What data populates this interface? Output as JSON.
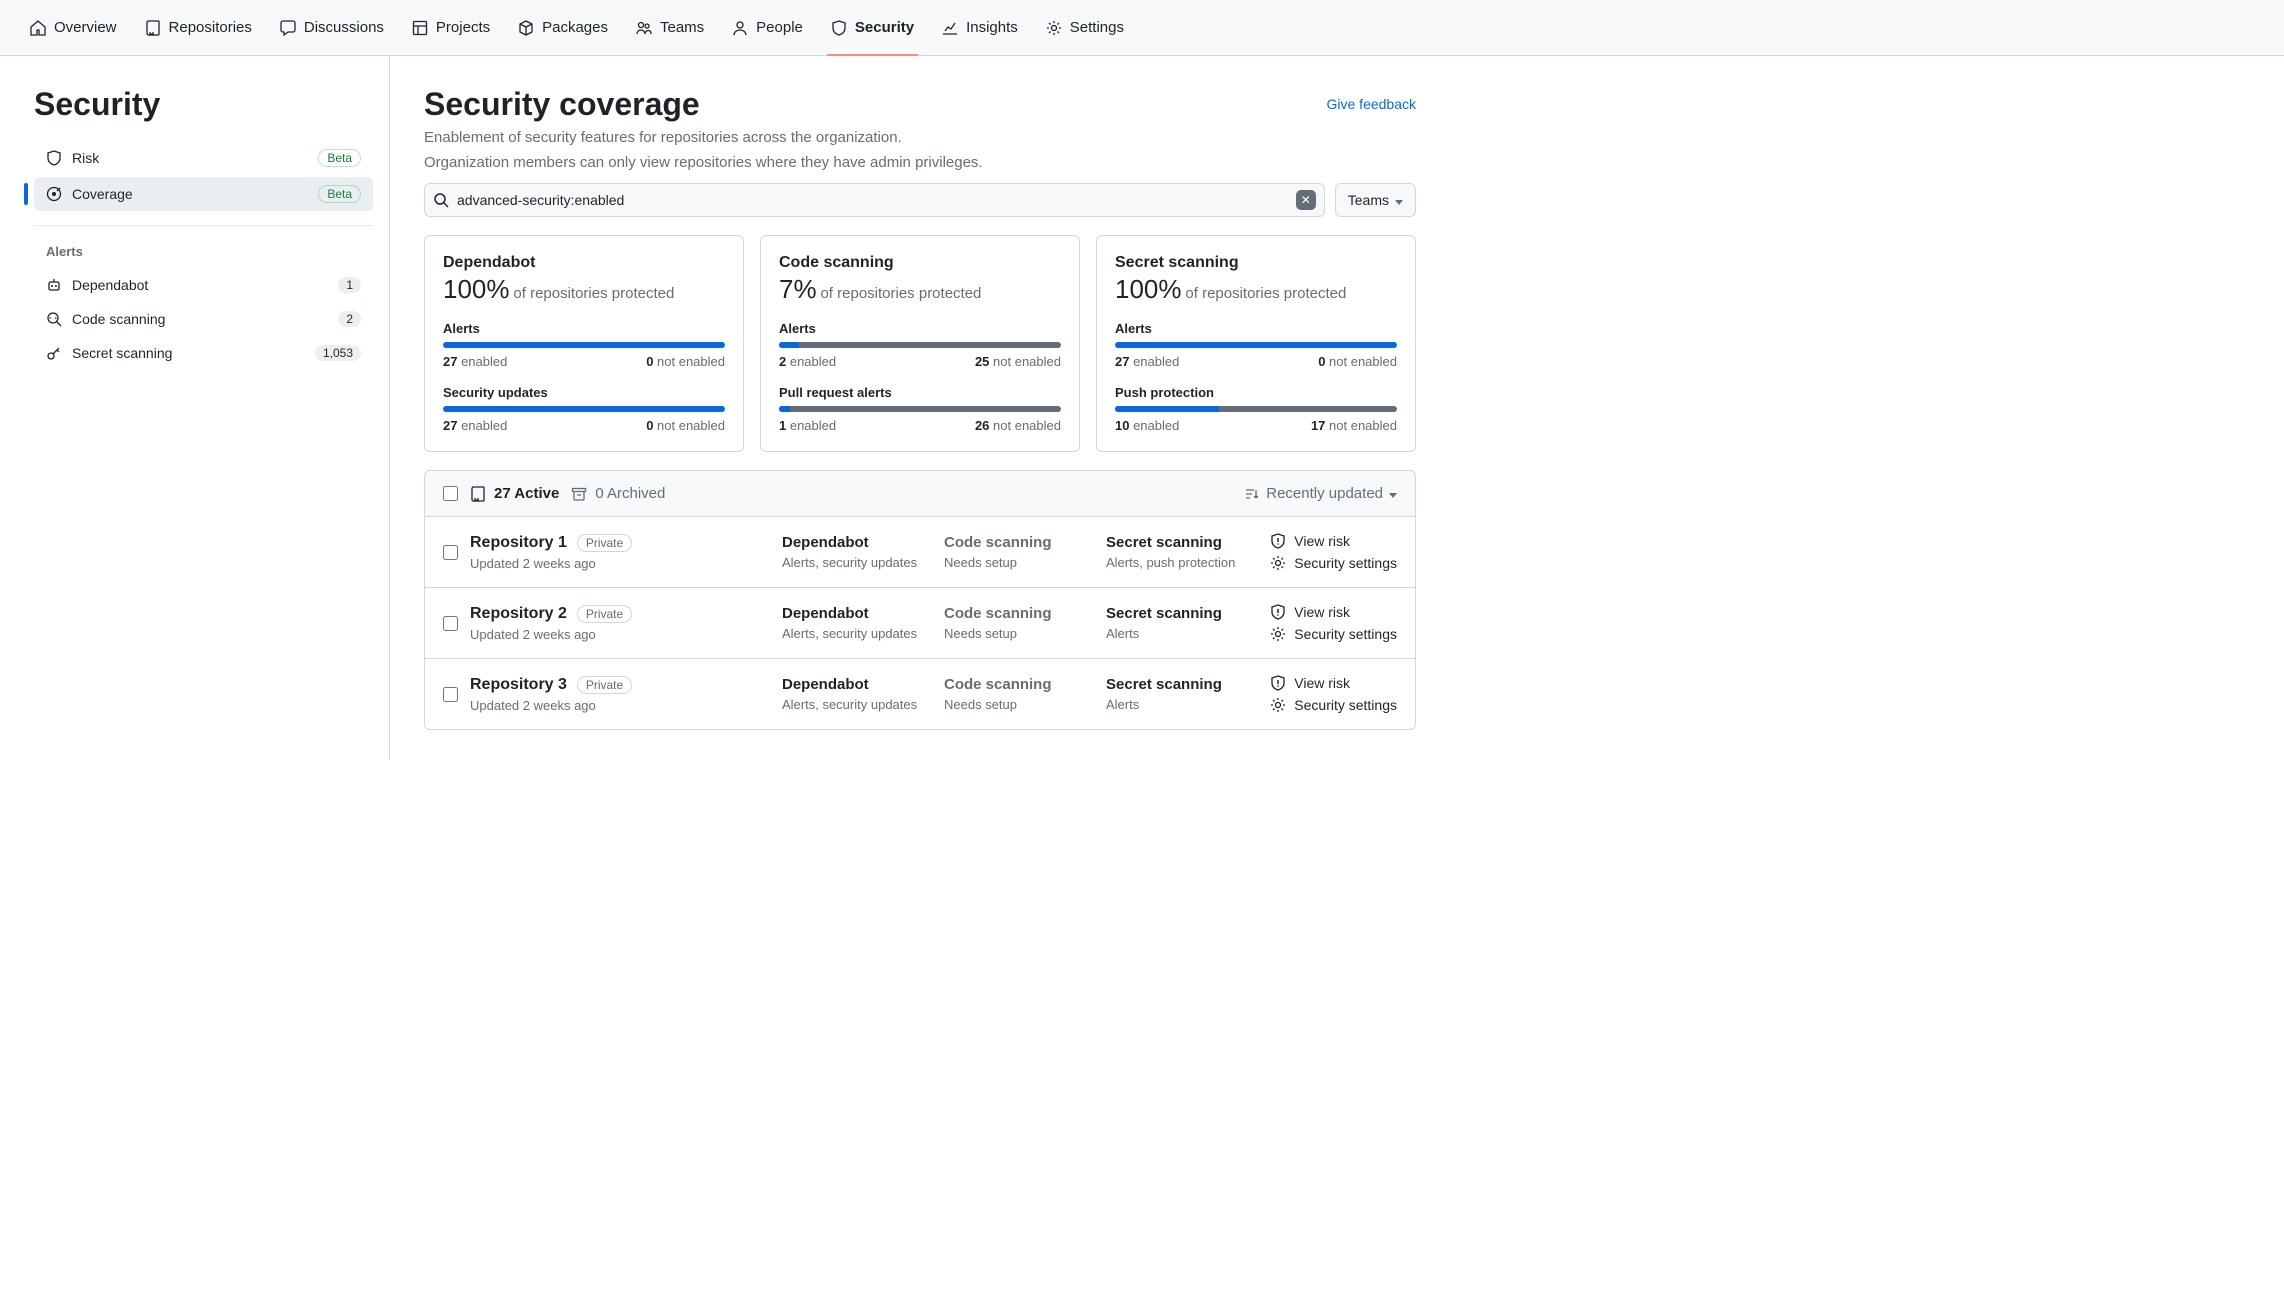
{
  "topnav": [
    {
      "label": "Overview",
      "icon": "home"
    },
    {
      "label": "Repositories",
      "icon": "repo"
    },
    {
      "label": "Discussions",
      "icon": "comment"
    },
    {
      "label": "Projects",
      "icon": "project"
    },
    {
      "label": "Packages",
      "icon": "package"
    },
    {
      "label": "Teams",
      "icon": "people"
    },
    {
      "label": "People",
      "icon": "person"
    },
    {
      "label": "Security",
      "icon": "shield",
      "active": true
    },
    {
      "label": "Insights",
      "icon": "graph"
    },
    {
      "label": "Settings",
      "icon": "gear"
    }
  ],
  "sidebar": {
    "title": "Security",
    "main": [
      {
        "label": "Risk",
        "icon": "shield",
        "badge": "Beta"
      },
      {
        "label": "Coverage",
        "icon": "target",
        "badge": "Beta",
        "active": true
      }
    ],
    "alerts_heading": "Alerts",
    "alerts": [
      {
        "label": "Dependabot",
        "icon": "bot",
        "count": "1"
      },
      {
        "label": "Code scanning",
        "icon": "codescan",
        "count": "2"
      },
      {
        "label": "Secret scanning",
        "icon": "key",
        "count": "1,053"
      }
    ]
  },
  "page": {
    "title": "Security coverage",
    "subtitle1": "Enablement of security features for repositories across the organization.",
    "subtitle2": "Organization members can only view repositories where they have admin privileges.",
    "feedback": "Give feedback",
    "search_value": "advanced-security:enabled",
    "teams_button": "Teams"
  },
  "cards": [
    {
      "title": "Dependabot",
      "pct": "100%",
      "pct_suffix": "of repositories protected",
      "metrics": [
        {
          "label": "Alerts",
          "enabled": 27,
          "not_enabled": 0,
          "fill": 100
        },
        {
          "label": "Security updates",
          "enabled": 27,
          "not_enabled": 0,
          "fill": 100
        }
      ]
    },
    {
      "title": "Code scanning",
      "pct": "7%",
      "pct_suffix": "of repositories protected",
      "metrics": [
        {
          "label": "Alerts",
          "enabled": 2,
          "not_enabled": 25,
          "fill": 7
        },
        {
          "label": "Pull request alerts",
          "enabled": 1,
          "not_enabled": 26,
          "fill": 4
        }
      ]
    },
    {
      "title": "Secret scanning",
      "pct": "100%",
      "pct_suffix": "of repositories protected",
      "metrics": [
        {
          "label": "Alerts",
          "enabled": 27,
          "not_enabled": 0,
          "fill": 100
        },
        {
          "label": "Push protection",
          "enabled": 10,
          "not_enabled": 17,
          "fill": 37
        }
      ]
    }
  ],
  "list": {
    "active_label": "27 Active",
    "archived_label": "0 Archived",
    "sort_label": "Recently updated",
    "enabled_word": "enabled",
    "not_enabled_word": "not enabled",
    "view_risk": "View risk",
    "security_settings": "Security settings",
    "rows": [
      {
        "name": "Repository 1",
        "visibility": "Private",
        "updated": "Updated 2 weeks ago",
        "dependabot": {
          "title": "Dependabot",
          "sub": "Alerts, security updates",
          "dim": false
        },
        "codescan": {
          "title": "Code scanning",
          "sub": "Needs setup",
          "dim": true
        },
        "secret": {
          "title": "Secret scanning",
          "sub": "Alerts, push protection",
          "dim": false
        }
      },
      {
        "name": "Repository 2",
        "visibility": "Private",
        "updated": "Updated 2 weeks ago",
        "dependabot": {
          "title": "Dependabot",
          "sub": "Alerts, security updates",
          "dim": false
        },
        "codescan": {
          "title": "Code scanning",
          "sub": "Needs setup",
          "dim": true
        },
        "secret": {
          "title": "Secret scanning",
          "sub": "Alerts",
          "dim": false
        }
      },
      {
        "name": "Repository 3",
        "visibility": "Private",
        "updated": "Updated 2 weeks ago",
        "dependabot": {
          "title": "Dependabot",
          "sub": "Alerts, security updates",
          "dim": false
        },
        "codescan": {
          "title": "Code scanning",
          "sub": "Needs setup",
          "dim": true
        },
        "secret": {
          "title": "Secret scanning",
          "sub": "Alerts",
          "dim": false
        }
      }
    ]
  }
}
